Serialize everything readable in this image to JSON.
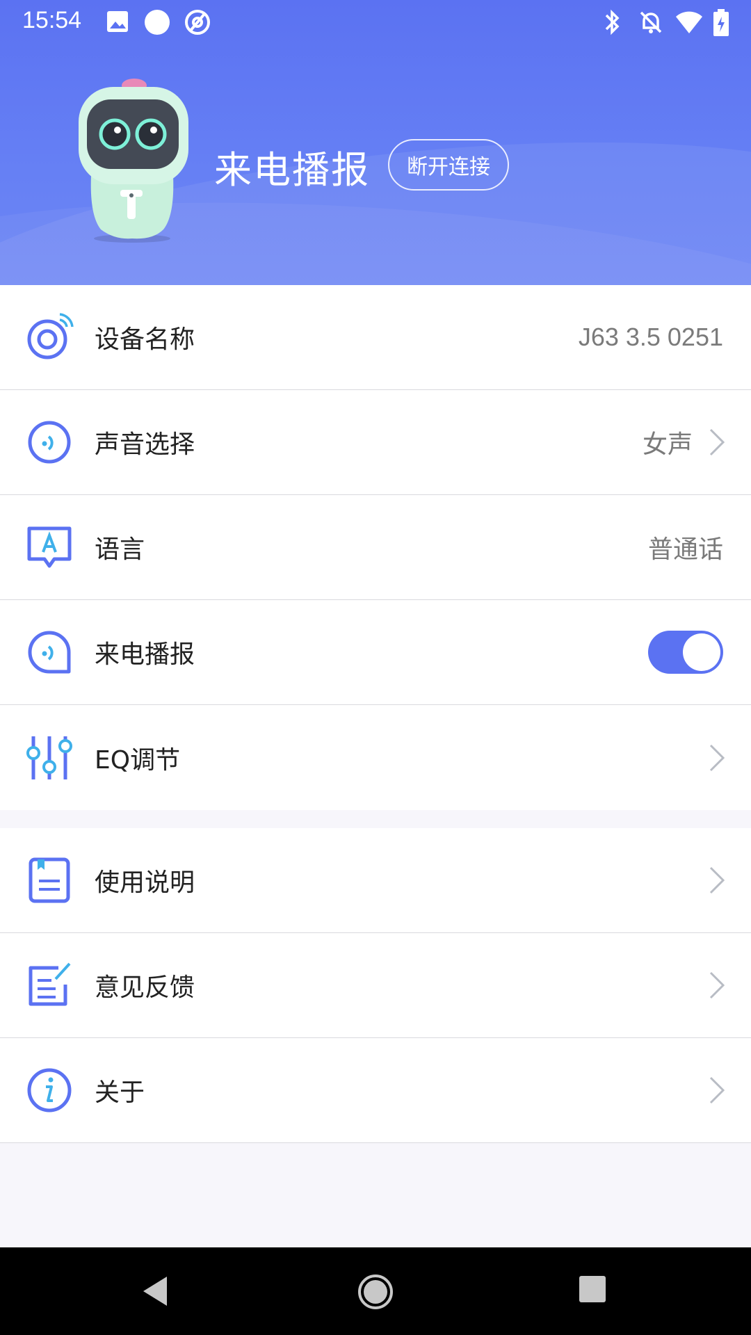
{
  "status_bar": {
    "time": "15:54",
    "left_icons": [
      "image-icon",
      "circle-dot-icon",
      "at-sign-icon"
    ],
    "right_icons": [
      "bluetooth-icon",
      "bell-off-icon",
      "wifi-icon",
      "battery-charging-icon"
    ]
  },
  "header": {
    "title": "来电播报",
    "disconnect_label": "断开连接",
    "brand_color": "#5b72f2"
  },
  "settings": {
    "items": [
      {
        "icon": "device-signal-icon",
        "label": "设备名称",
        "value": "J63 3.5 0251",
        "chevron": false
      },
      {
        "icon": "voice-icon",
        "label": "声音选择",
        "value": "女声",
        "chevron": true
      },
      {
        "icon": "language-icon",
        "label": "语言",
        "value": "普通话",
        "chevron": false
      },
      {
        "icon": "call-broadcast-icon",
        "label": "来电播报",
        "toggle": true,
        "toggle_on": true
      },
      {
        "icon": "equalizer-icon",
        "label": "EQ调节",
        "chevron": true
      }
    ]
  },
  "more": {
    "items": [
      {
        "icon": "manual-icon",
        "label": "使用说明",
        "chevron": true
      },
      {
        "icon": "feedback-icon",
        "label": "意见反馈",
        "chevron": true
      },
      {
        "icon": "info-icon",
        "label": "关于",
        "chevron": true
      }
    ]
  },
  "navbar": {
    "buttons": [
      "back-icon",
      "home-icon",
      "recents-icon"
    ]
  }
}
